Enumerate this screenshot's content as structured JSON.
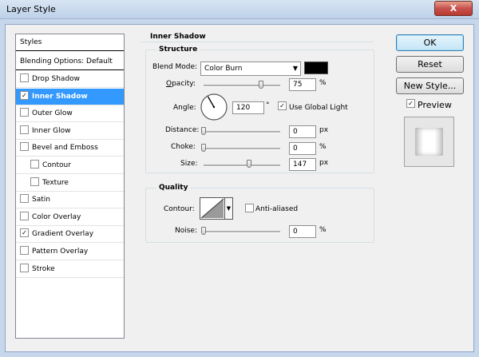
{
  "window": {
    "title": "Layer Style",
    "close_label": "X"
  },
  "styles_list": {
    "header": "Styles",
    "blending": "Blending Options: Default",
    "items": [
      {
        "label": "Drop Shadow",
        "checked": false
      },
      {
        "label": "Inner Shadow",
        "checked": true,
        "selected": true
      },
      {
        "label": "Outer Glow",
        "checked": false
      },
      {
        "label": "Inner Glow",
        "checked": false
      },
      {
        "label": "Bevel and Emboss",
        "checked": false
      },
      {
        "label": "Contour",
        "checked": false
      },
      {
        "label": "Texture",
        "checked": false
      },
      {
        "label": "Satin",
        "checked": false
      },
      {
        "label": "Color Overlay",
        "checked": false
      },
      {
        "label": "Gradient Overlay",
        "checked": true
      },
      {
        "label": "Pattern Overlay",
        "checked": false
      },
      {
        "label": "Stroke",
        "checked": false
      }
    ]
  },
  "inner_shadow": {
    "section_title": "Inner Shadow",
    "structure_title": "Structure",
    "blend_mode_label": "Blend Mode:",
    "blend_mode_value": "Color Burn",
    "blend_color": "#000000",
    "opacity_label": "Opacity:",
    "opacity_value": "75",
    "opacity_unit": "%",
    "angle_label": "Angle:",
    "angle_value": "120",
    "angle_unit": "°",
    "use_global_light_label": "Use Global Light",
    "use_global_light": true,
    "distance_label": "Distance:",
    "distance_value": "0",
    "distance_unit": "px",
    "choke_label": "Choke:",
    "choke_value": "0",
    "choke_unit": "%",
    "size_label": "Size:",
    "size_value": "147",
    "size_unit": "px",
    "opacity_level": 0.75,
    "distance_level": 0,
    "choke_level": 0,
    "size_level": 0.59
  },
  "quality": {
    "title": "Quality",
    "contour_label": "Contour:",
    "anti_aliased_label": "Anti-aliased",
    "anti_aliased": false,
    "noise_label": "Noise:",
    "noise_value": "0",
    "noise_unit": "%",
    "noise_level": 0
  },
  "buttons": {
    "ok": "OK",
    "reset": "Reset",
    "new_style": "New Style...",
    "preview_label": "Preview",
    "preview_checked": true
  }
}
